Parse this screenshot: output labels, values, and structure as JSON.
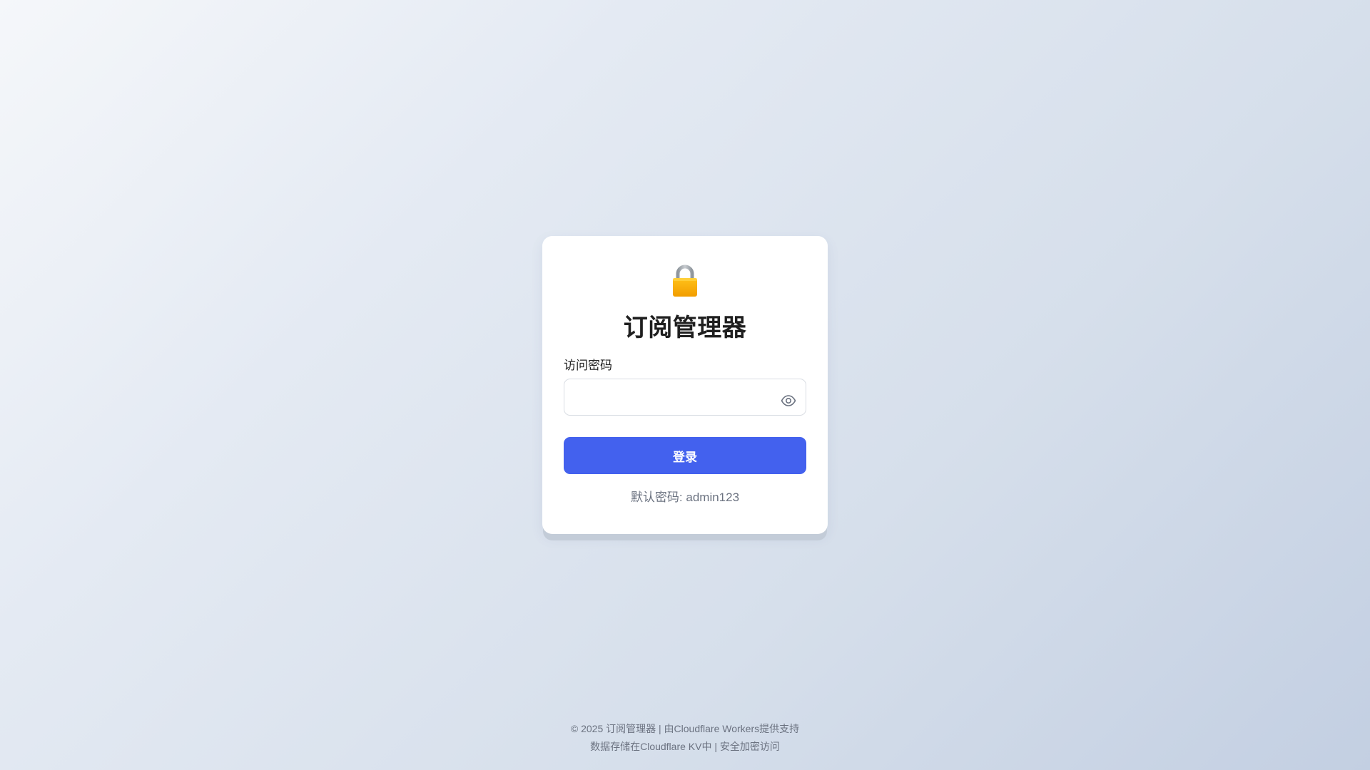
{
  "login": {
    "title": "订阅管理器",
    "password_label": "访问密码",
    "password_value": "",
    "password_placeholder": "",
    "submit_label": "登录",
    "hint": "默认密码: admin123",
    "icons": {
      "header": "lock-icon",
      "toggle": "eye-icon"
    }
  },
  "footer": {
    "line1": "© 2025 订阅管理器 | 由Cloudflare Workers提供支持",
    "line2": "数据存储在Cloudflare KV中 | 安全加密访问"
  },
  "colors": {
    "accent": "#4361ee",
    "lock_body": "#f5b400",
    "lock_shackle": "#9aa0a6"
  }
}
